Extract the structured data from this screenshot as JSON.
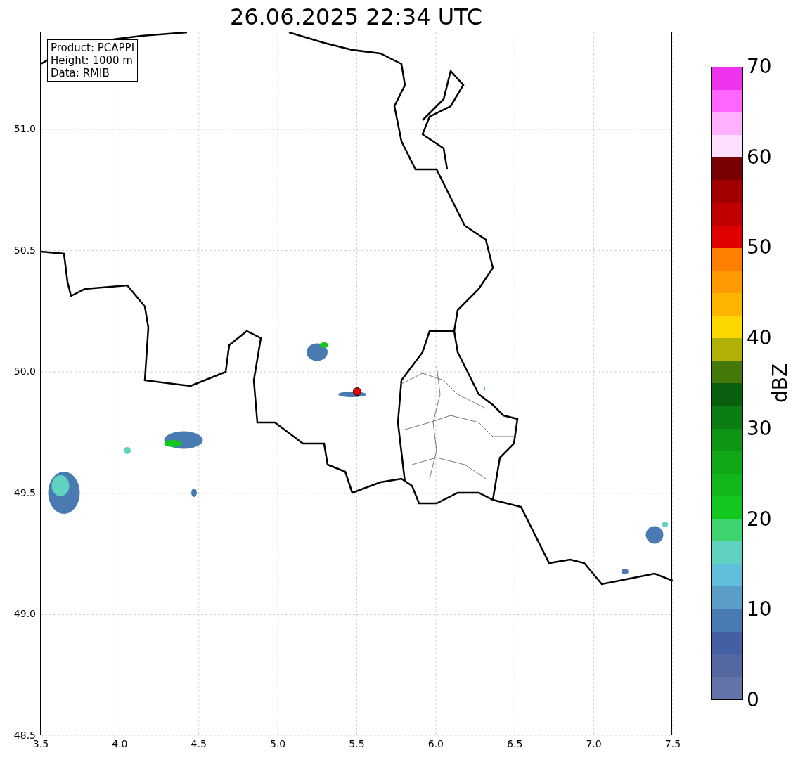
{
  "title": "26.06.2025 22:34 UTC",
  "info_box": [
    "Product: PCAPPI",
    "Height: 1000 m",
    "Data: RMIB"
  ],
  "x_axis": {
    "ticks": [
      "3.5",
      "4.0",
      "4.5",
      "5.0",
      "5.5",
      "6.0",
      "6.5",
      "7.0",
      "7.5"
    ]
  },
  "y_axis": {
    "ticks": [
      "51.0",
      "50.5",
      "50.0",
      "49.5",
      "49.0",
      "48.5"
    ]
  },
  "colorbar": {
    "label": "dBZ",
    "ticks": [
      "70",
      "60",
      "50",
      "40",
      "30",
      "20",
      "10",
      "0"
    ],
    "bins": [
      {
        "color": "#6373a8"
      },
      {
        "color": "#5467a0"
      },
      {
        "color": "#4260a3"
      },
      {
        "color": "#4a7ab2"
      },
      {
        "color": "#5a9ec8"
      },
      {
        "color": "#62bfdb"
      },
      {
        "color": "#5fd3c0"
      },
      {
        "color": "#3dd470"
      },
      {
        "color": "#12c81f"
      },
      {
        "color": "#12b81b"
      },
      {
        "color": "#10a817"
      },
      {
        "color": "#0e9514"
      },
      {
        "color": "#0b7d12"
      },
      {
        "color": "#085f0d"
      },
      {
        "color": "#457a0a"
      },
      {
        "color": "#b0b005"
      },
      {
        "color": "#ffd700"
      },
      {
        "color": "#ffb500"
      },
      {
        "color": "#ff9a00"
      },
      {
        "color": "#ff7f00"
      },
      {
        "color": "#e10000"
      },
      {
        "color": "#c00000"
      },
      {
        "color": "#a00000"
      },
      {
        "color": "#780000"
      },
      {
        "color": "#ffdfff"
      },
      {
        "color": "#ffb0ff"
      },
      {
        "color": "#ff66ff"
      },
      {
        "color": "#ee33ee"
      }
    ]
  }
}
